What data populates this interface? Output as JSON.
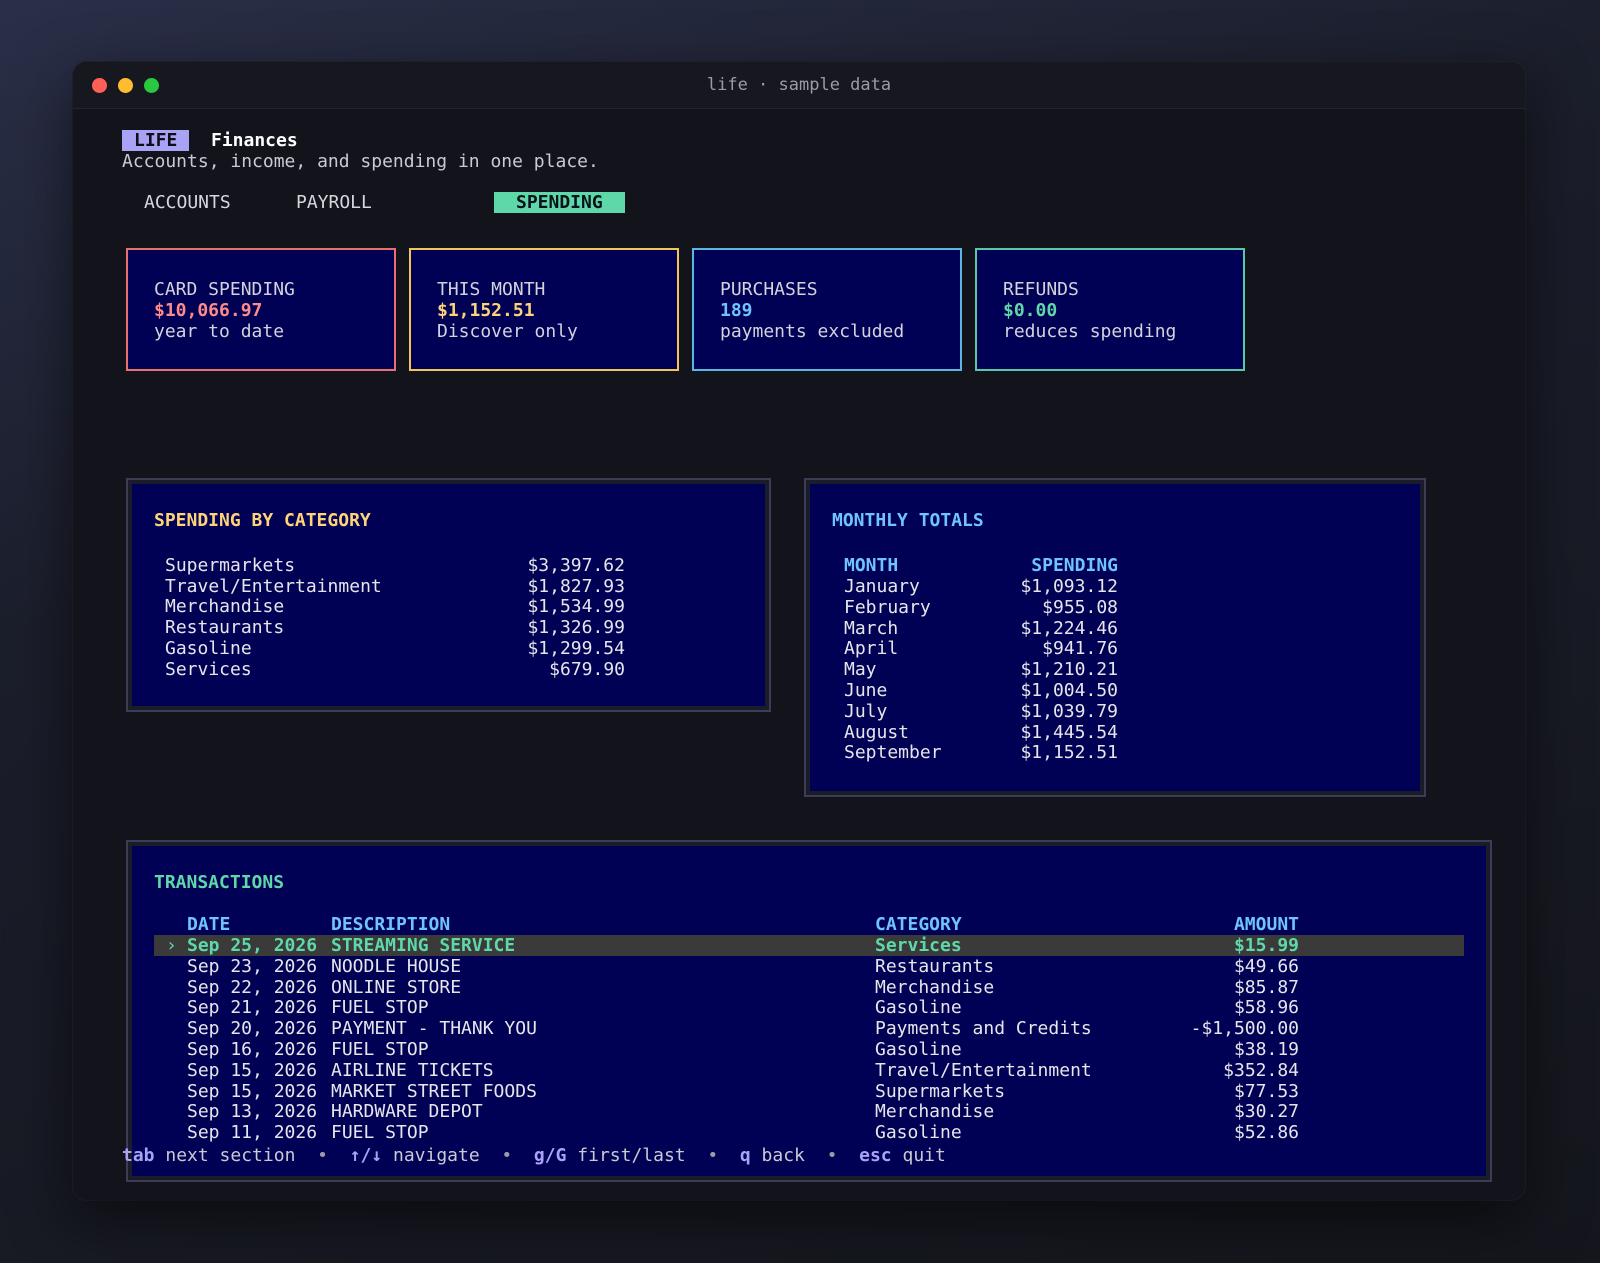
{
  "window": {
    "title": "life · sample data"
  },
  "header": {
    "badge": "LIFE",
    "title": "Finances",
    "subtitle": "Accounts, income, and spending in one place."
  },
  "tabs": [
    {
      "label": "ACCOUNTS",
      "active": false
    },
    {
      "label": "PAYROLL",
      "active": false
    },
    {
      "label": "SPENDING",
      "active": true
    }
  ],
  "cards": [
    {
      "label": "CARD SPENDING",
      "value": "$10,066.97",
      "sub": "year to date",
      "color": "#ff8a8a",
      "border": "#e8716e"
    },
    {
      "label": "THIS MONTH",
      "value": "$1,152.51",
      "sub": "Discover only",
      "color": "#ffd479",
      "border": "#f2c45a"
    },
    {
      "label": "PURCHASES",
      "value": "189",
      "sub": "payments excluded",
      "color": "#6fc3ff",
      "border": "#5ab8e0"
    },
    {
      "label": "REFUNDS",
      "value": "$0.00",
      "sub": "reduces spending",
      "color": "#5fd8a9",
      "border": "#56c9a8"
    }
  ],
  "category_panel": {
    "title": "SPENDING BY CATEGORY",
    "title_color": "#ffd479",
    "rows": [
      {
        "name": "Supermarkets",
        "amount": "$3,397.62"
      },
      {
        "name": "Travel/Entertainment",
        "amount": "$1,827.93"
      },
      {
        "name": "Merchandise",
        "amount": "$1,534.99"
      },
      {
        "name": "Restaurants",
        "amount": "$1,326.99"
      },
      {
        "name": "Gasoline",
        "amount": "$1,299.54"
      },
      {
        "name": "Services",
        "amount": "$679.90"
      }
    ]
  },
  "monthly_panel": {
    "title": "MONTHLY TOTALS",
    "title_color": "#6fc3ff",
    "headers": {
      "month": "MONTH",
      "spending": "SPENDING"
    },
    "rows": [
      {
        "month": "January",
        "amount": "$1,093.12"
      },
      {
        "month": "February",
        "amount": "$955.08"
      },
      {
        "month": "March",
        "amount": "$1,224.46"
      },
      {
        "month": "April",
        "amount": "$941.76"
      },
      {
        "month": "May",
        "amount": "$1,210.21"
      },
      {
        "month": "June",
        "amount": "$1,004.50"
      },
      {
        "month": "July",
        "amount": "$1,039.79"
      },
      {
        "month": "August",
        "amount": "$1,445.54"
      },
      {
        "month": "September",
        "amount": "$1,152.51"
      }
    ]
  },
  "transactions_panel": {
    "title": "TRANSACTIONS",
    "title_color": "#5fd8a9",
    "selected_marker": "›",
    "headers": {
      "date": "DATE",
      "description": "DESCRIPTION",
      "category": "CATEGORY",
      "amount": "AMOUNT"
    },
    "rows": [
      {
        "date": "Sep 25, 2026",
        "description": "STREAMING SERVICE",
        "category": "Services",
        "amount": "$15.99",
        "selected": true
      },
      {
        "date": "Sep 23, 2026",
        "description": "NOODLE HOUSE",
        "category": "Restaurants",
        "amount": "$49.66"
      },
      {
        "date": "Sep 22, 2026",
        "description": "ONLINE STORE",
        "category": "Merchandise",
        "amount": "$85.87"
      },
      {
        "date": "Sep 21, 2026",
        "description": "FUEL STOP",
        "category": "Gasoline",
        "amount": "$58.96"
      },
      {
        "date": "Sep 20, 2026",
        "description": "PAYMENT - THANK YOU",
        "category": "Payments and Credits",
        "amount": "-$1,500.00"
      },
      {
        "date": "Sep 16, 2026",
        "description": "FUEL STOP",
        "category": "Gasoline",
        "amount": "$38.19"
      },
      {
        "date": "Sep 15, 2026",
        "description": "AIRLINE TICKETS",
        "category": "Travel/Entertainment",
        "amount": "$352.84"
      },
      {
        "date": "Sep 15, 2026",
        "description": "MARKET STREET FOODS",
        "category": "Supermarkets",
        "amount": "$77.53"
      },
      {
        "date": "Sep 13, 2026",
        "description": "HARDWARE DEPOT",
        "category": "Merchandise",
        "amount": "$30.27"
      },
      {
        "date": "Sep 11, 2026",
        "description": "FUEL STOP",
        "category": "Gasoline",
        "amount": "$52.86"
      }
    ]
  },
  "footer": [
    {
      "key": "tab",
      "action": "next section"
    },
    {
      "key": "↑/↓",
      "action": "navigate"
    },
    {
      "key": "g/G",
      "action": "first/last"
    },
    {
      "key": "q",
      "action": "back"
    },
    {
      "key": "esc",
      "action": "quit"
    }
  ],
  "footer_separator": "•"
}
